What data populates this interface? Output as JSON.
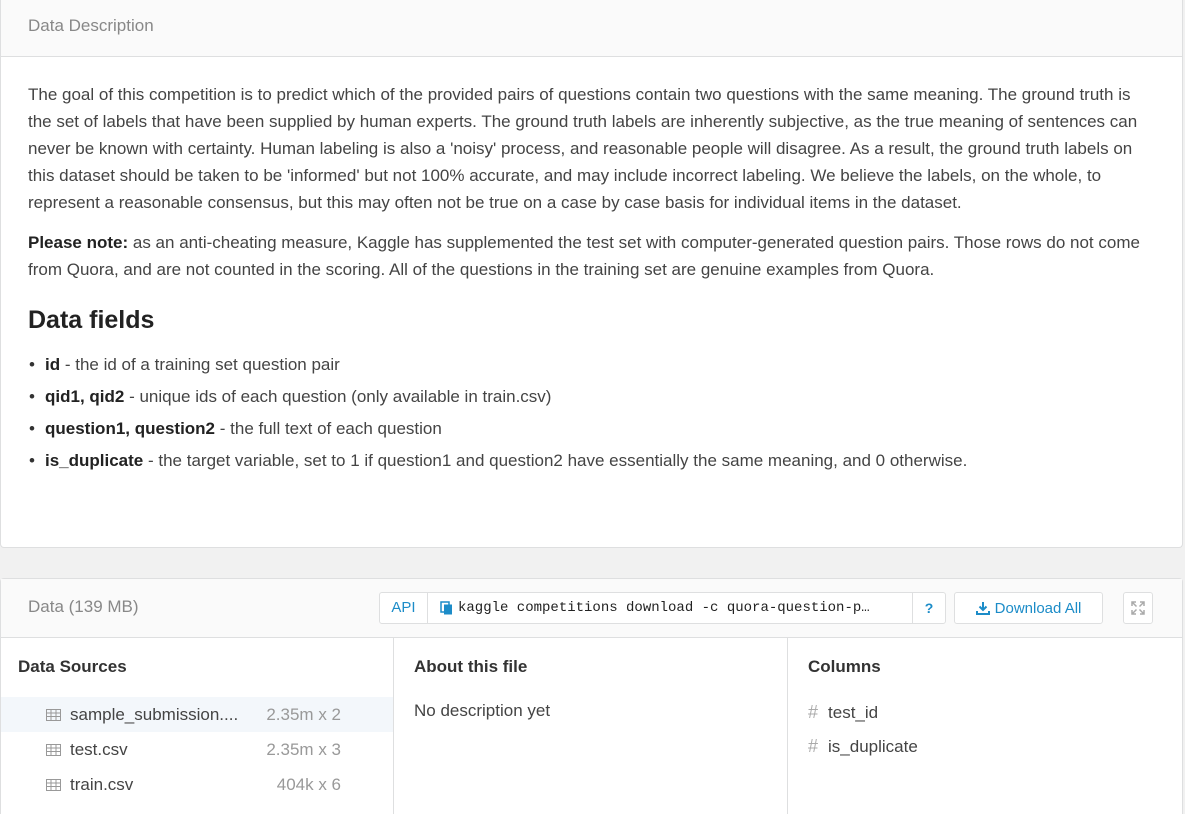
{
  "description": {
    "header": "Data Description",
    "paragraph1": "The goal of this competition is to predict which of the provided pairs of questions contain two questions with the same meaning. The ground truth is the set of labels that have been supplied by human experts. The ground truth labels are inherently subjective, as the true meaning of sentences can never be known with certainty. Human labeling is also a 'noisy' process, and reasonable people will disagree. As a result, the ground truth labels on this dataset should be taken to be 'informed' but not 100% accurate, and may include incorrect labeling. We believe the labels, on the whole, to represent a reasonable consensus, but this may often not be true on a case by case basis for individual items in the dataset.",
    "note_label": "Please note:",
    "note_text": " as an anti-cheating measure, Kaggle has supplemented the test set with computer-generated question pairs. Those rows do not come from Quora, and are not counted in the scoring. All of the questions in the training set are genuine examples from Quora.",
    "fields_heading": "Data fields",
    "fields": [
      {
        "name": "id",
        "desc": " - the id of a training set question pair"
      },
      {
        "name": "qid1, qid2",
        "desc": " - unique ids of each question (only available in train.csv)"
      },
      {
        "name": "question1, question2",
        "desc": " - the full text of each question"
      },
      {
        "name": "is_duplicate",
        "desc": " - the target variable, set to 1 if question1 and question2 have essentially the same meaning, and 0 otherwise."
      }
    ]
  },
  "data": {
    "header": "Data (139 MB)",
    "api_label": "API",
    "command": "kaggle competitions download -c quora-question-p…",
    "help_label": "?",
    "download_label": "Download All",
    "sources_title": "Data Sources",
    "sources": [
      {
        "name": "sample_submission....",
        "size": "2.35m x 2"
      },
      {
        "name": "test.csv",
        "size": "2.35m x 3"
      },
      {
        "name": "train.csv",
        "size": "404k x 6"
      }
    ],
    "about_title": "About this file",
    "about_text": "No description yet",
    "columns_title": "Columns",
    "columns": [
      "test_id",
      "is_duplicate"
    ],
    "colors": {
      "accent": "#1c8cc8",
      "border": "#dedfe0",
      "selected_row": "#f3f7fb"
    }
  }
}
